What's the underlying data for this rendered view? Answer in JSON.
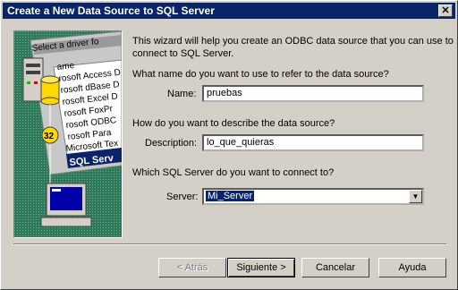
{
  "window": {
    "title": "Create a New Data Source to SQL Server",
    "close_glyph": "✕"
  },
  "illustration": {
    "caption": "Select a driver fo",
    "drivers": [
      "ame",
      "rosoft Access D",
      "rosoft dBase D",
      "rosoft Excel D",
      "rosoft FoxPr",
      "rosoft ODBC",
      "rosoft Para",
      "Microsoft Tex",
      "SQL Serv"
    ],
    "badge": "32"
  },
  "intro": {
    "line1": "This wizard will help you create an ODBC data source that you can use to",
    "line2": "connect to SQL Server."
  },
  "name_section": {
    "question": "What name do you want to use to refer to the data source?",
    "label": "Name:",
    "value": "pruebas"
  },
  "description_section": {
    "question": "How do you want to describe the data source?",
    "label": "Description:",
    "value": "lo_que_quieras"
  },
  "server_section": {
    "question": "Which SQL Server do you want to connect to?",
    "label": "Server:",
    "value": "Mi_Server"
  },
  "buttons": {
    "back": "< Atrás",
    "next": "Siguiente >",
    "cancel": "Cancelar",
    "help": "Ayuda"
  },
  "colors": {
    "titlebar": "#0a246a",
    "dialog": "#d4d0c8",
    "selection": "#0a246a"
  }
}
